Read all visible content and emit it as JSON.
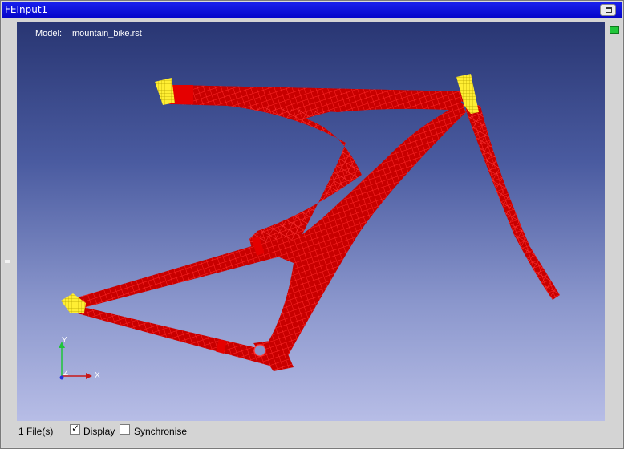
{
  "window": {
    "title": "FEInput1"
  },
  "viewport": {
    "model_label": "Model:",
    "model_name": "mountain_bike.rst",
    "axes": {
      "y": "Y",
      "z": "Z",
      "x": "X"
    }
  },
  "statusbar": {
    "files": "1 File(s)",
    "display_label": "Display",
    "display_checked": true,
    "synchronise_label": "Synchronise",
    "synchronise_checked": false
  },
  "colors": {
    "mesh": "#e50000",
    "constraint": "#ffee33",
    "title_bar": "#0a10dd",
    "indicator": "#21c63b"
  },
  "icons": [
    "restore-icon",
    "checkmark-icon",
    "axis-triad-icon"
  ]
}
